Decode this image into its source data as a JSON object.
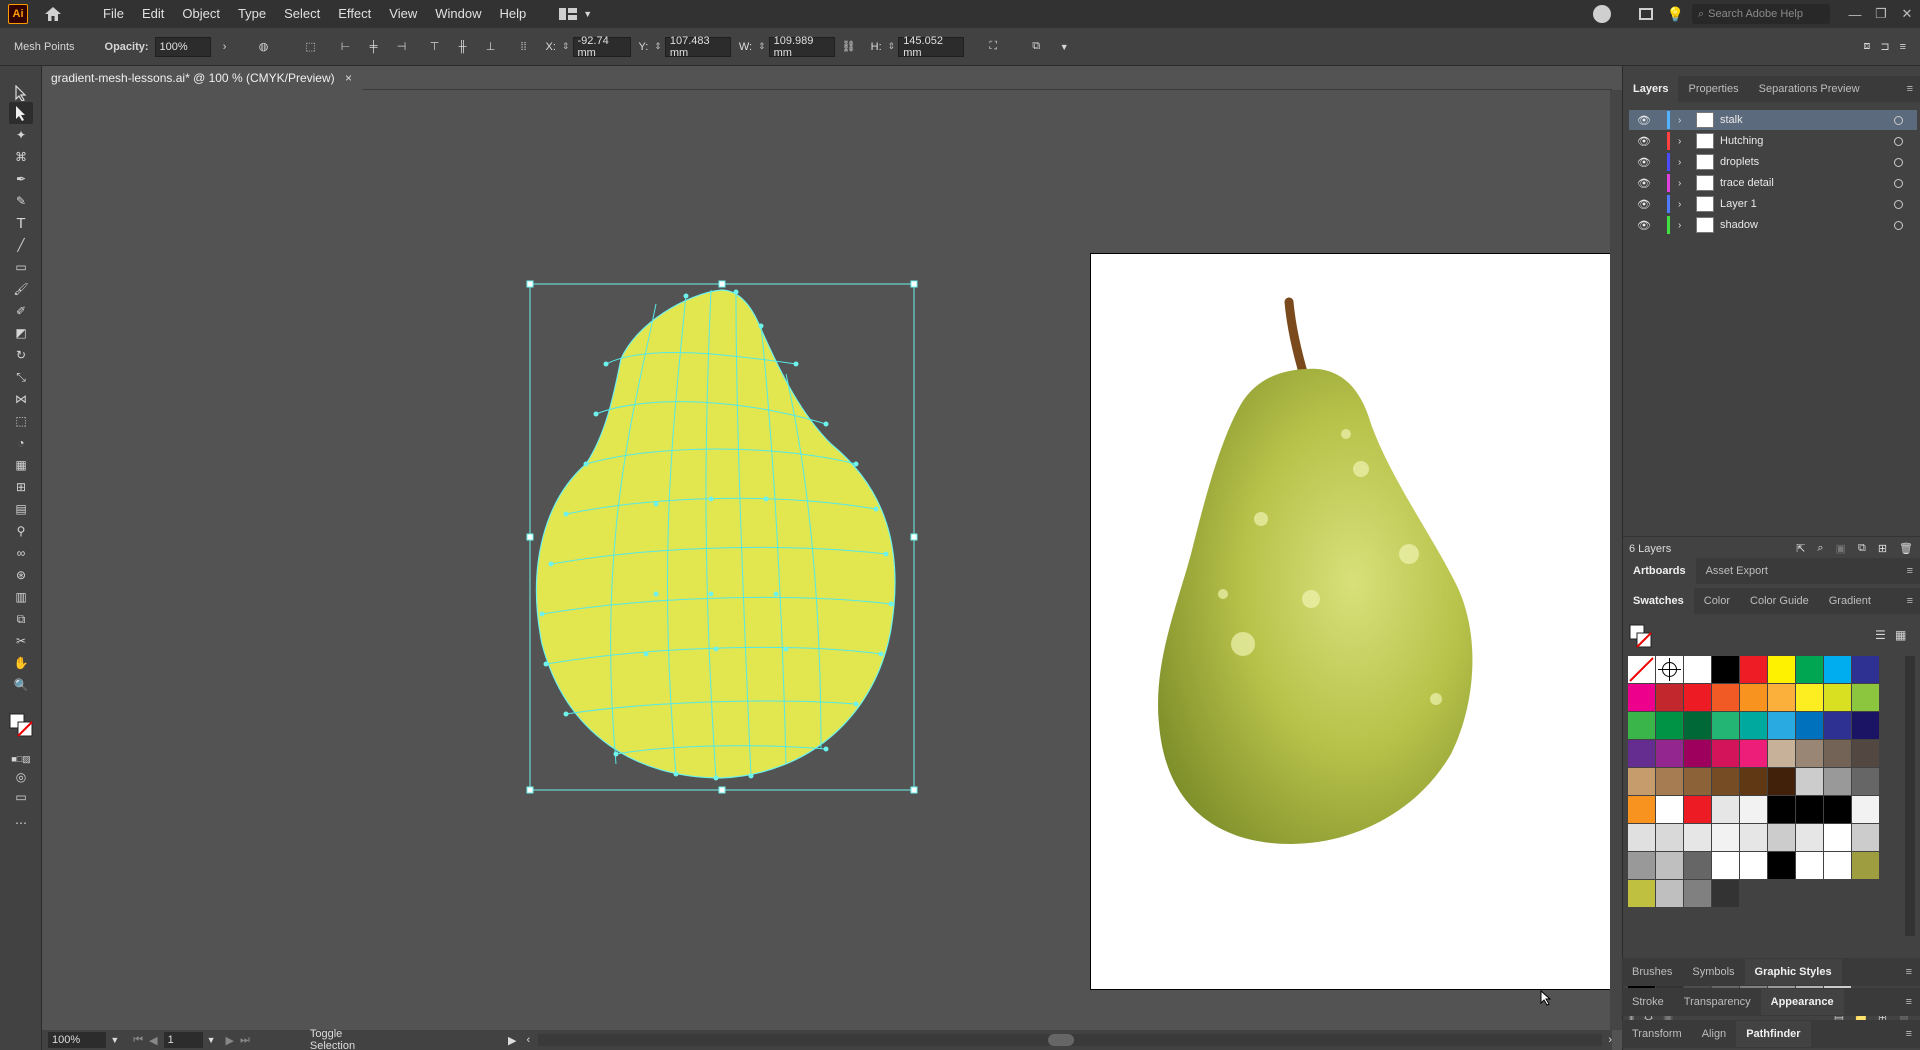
{
  "app": {
    "logo": "Ai"
  },
  "menu": [
    "File",
    "Edit",
    "Object",
    "Type",
    "Select",
    "Effect",
    "View",
    "Window",
    "Help"
  ],
  "search": {
    "placeholder": "Search Adobe Help"
  },
  "control": {
    "mode": "Mesh Points",
    "opacity_label": "Opacity:",
    "opacity_value": "100%",
    "x_label": "X:",
    "x_value": "-92.74 mm",
    "y_label": "Y:",
    "y_value": "107.483 mm",
    "w_label": "W:",
    "w_value": "109.989 mm",
    "h_label": "H:",
    "h_value": "145.052 mm"
  },
  "document": {
    "tab_title": "gradient-mesh-lessons.ai* @ 100 % (CMYK/Preview)",
    "close": "×"
  },
  "panels": {
    "top_tabs": [
      "Layers",
      "Properties",
      "Separations Preview"
    ],
    "layers": [
      {
        "name": "stalk",
        "color": "#4fb3ff",
        "selected": true
      },
      {
        "name": "Hutching",
        "color": "#ff4040",
        "selected": false
      },
      {
        "name": "droplets",
        "color": "#4b4bff",
        "selected": false
      },
      {
        "name": "trace detail",
        "color": "#e040e0",
        "selected": false
      },
      {
        "name": "Layer 1",
        "color": "#4f7bff",
        "selected": false
      },
      {
        "name": "shadow",
        "color": "#40e040",
        "selected": false
      }
    ],
    "layer_count": "6 Layers",
    "mid_tabs": [
      "Artboards",
      "Asset Export"
    ],
    "swatch_tabs": [
      "Swatches",
      "Color",
      "Color Guide",
      "Gradient"
    ],
    "bottom_tabs_1": [
      "Brushes",
      "Symbols",
      "Graphic Styles"
    ],
    "bottom_tabs_2": [
      "Stroke",
      "Transparency",
      "Appearance"
    ],
    "bottom_tabs_3": [
      "Transform",
      "Align",
      "Pathfinder"
    ],
    "swatches": [
      "#ffffff",
      "#ffffff",
      "#ffffff",
      "#000000",
      "#ee1c25",
      "#fff200",
      "#00a651",
      "#00aeef",
      "#2e3192",
      "#ec008c",
      "#c1272d",
      "#ed1c24",
      "#f15a24",
      "#f7931e",
      "#fbb03b",
      "#fcee21",
      "#d9e021",
      "#8cc63f",
      "#39b54a",
      "#009245",
      "#006837",
      "#22b573",
      "#00a99d",
      "#29abe2",
      "#0071bc",
      "#2e3192",
      "#1b1464",
      "#662d91",
      "#93278f",
      "#9e005d",
      "#d4145a",
      "#ed1e79",
      "#c7b299",
      "#998675",
      "#736357",
      "#534741",
      "#c69c6d",
      "#a67c52",
      "#8c6239",
      "#754c24",
      "#603813",
      "#42210b",
      "#cccccc",
      "#999999",
      "#666666",
      "#f7931e",
      "#ffffff",
      "#ed1c24",
      "#e6e6e6",
      "#f2f2f2",
      "#000000",
      "#000000",
      "#000000",
      "#f2f2f2",
      "#e0e0e0",
      "#d9d9d9",
      "#e6e6e6",
      "#f2f2f2",
      "#e6e6e6",
      "#cccccc",
      "#e6e6e6",
      "#ffffff",
      "#cccccc",
      "#999999",
      "#bfbfbf",
      "#666666",
      "#ffffff",
      "#ffffff",
      "#000000",
      "#ffffff",
      "#ffffff",
      "#9e9e40",
      "#c0c040",
      "#bfbfbf",
      "#808080",
      "#333333"
    ],
    "swatch_row2": [
      "#000000",
      "#333333",
      "#4d4d4d",
      "#666666",
      "#808080",
      "#999999",
      "#b3b3b3",
      "#cccccc"
    ]
  },
  "status": {
    "zoom": "100%",
    "page": "1",
    "tool": "Toggle Selection"
  }
}
